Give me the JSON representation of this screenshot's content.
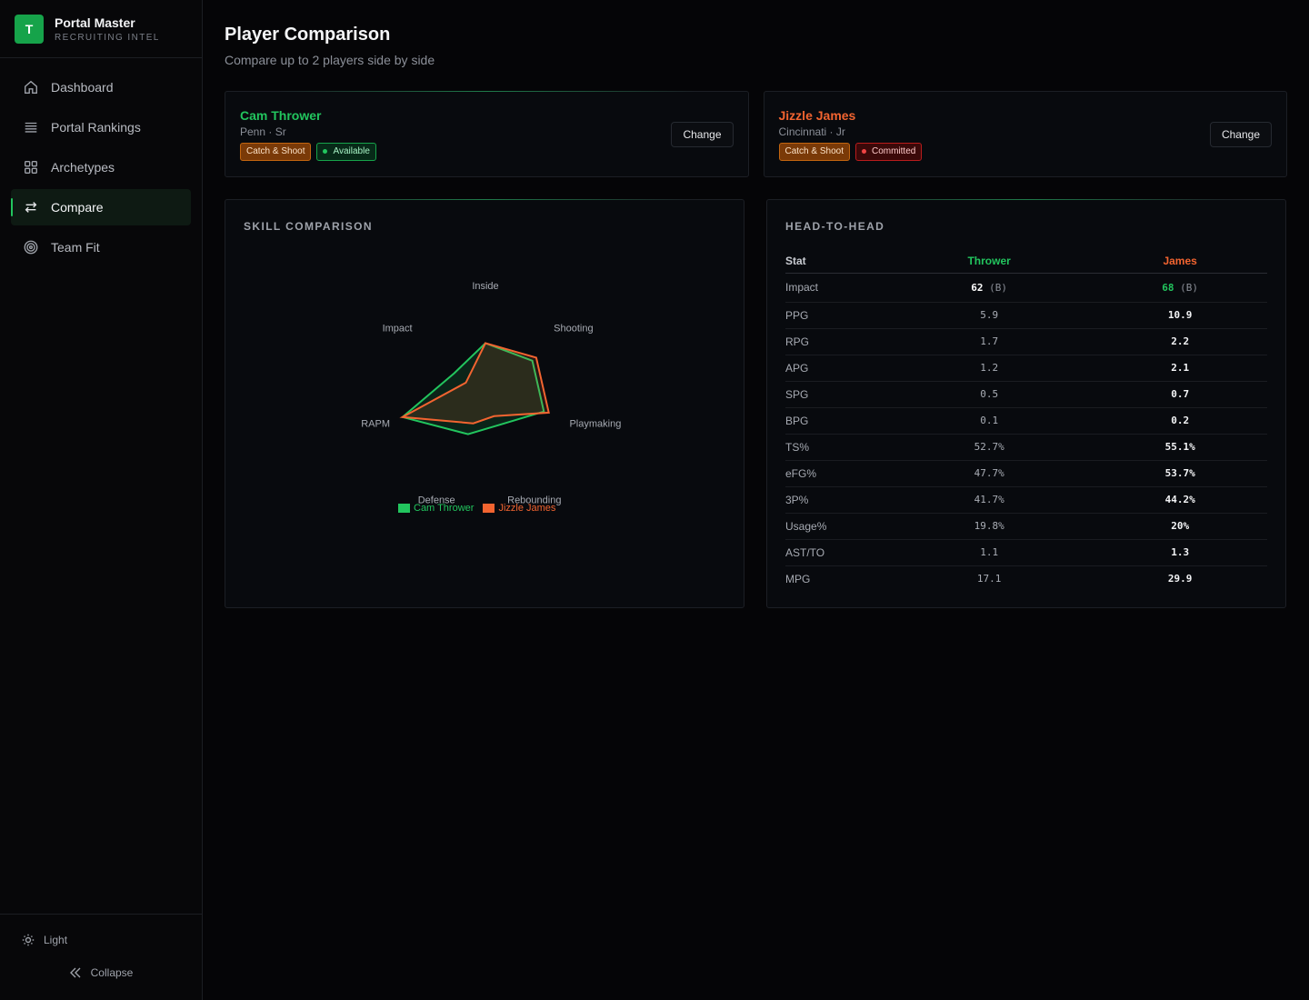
{
  "brand": {
    "logo_letter": "T",
    "name": "Portal Master",
    "subtitle": "RECRUITING INTEL"
  },
  "nav": [
    {
      "label": "Dashboard",
      "icon": "home-icon",
      "active": false
    },
    {
      "label": "Portal Rankings",
      "icon": "list-icon",
      "active": false
    },
    {
      "label": "Archetypes",
      "icon": "grid-icon",
      "active": false
    },
    {
      "label": "Compare",
      "icon": "swap-arrows-icon",
      "active": true
    },
    {
      "label": "Team Fit",
      "icon": "target-icon",
      "active": false
    }
  ],
  "footer": {
    "theme_label": "Light",
    "collapse_label": "Collapse"
  },
  "page": {
    "title": "Player Comparison",
    "subtitle": "Compare up to 2 players side by side"
  },
  "players": [
    {
      "name": "Cam Thrower",
      "meta": "Penn · Sr",
      "archetype": "Catch & Shoot",
      "status": "Available",
      "color": "#22c55e",
      "change_label": "Change"
    },
    {
      "name": "Jizzle James",
      "meta": "Cincinnati · Jr",
      "archetype": "Catch & Shoot",
      "status": "Committed",
      "color": "#f26430",
      "change_label": "Change"
    }
  ],
  "skill_panel": {
    "title": "SKILL COMPARISON"
  },
  "chart_data": {
    "type": "radar",
    "axes": [
      "Inside",
      "Shooting",
      "Playmaking",
      "Rebounding",
      "Defense",
      "RAPM",
      "Impact"
    ],
    "range": [
      0,
      100
    ],
    "series": [
      {
        "name": "Cam Thrower",
        "color": "#22c55e",
        "values": [
          55,
          60,
          60,
          30,
          40,
          85,
          40
        ]
      },
      {
        "name": "Jizzle James",
        "color": "#f26430",
        "values": [
          55,
          65,
          65,
          20,
          28,
          85,
          25
        ]
      }
    ]
  },
  "h2h": {
    "title": "HEAD-TO-HEAD",
    "headers": [
      "Stat",
      "Thrower",
      "James"
    ],
    "impact": {
      "label": "Impact",
      "thrower": "62",
      "thrower_grade": "(B)",
      "james": "68",
      "james_grade": "(B)"
    },
    "rows": [
      [
        "PPG",
        "5.9",
        "10.9"
      ],
      [
        "RPG",
        "1.7",
        "2.2"
      ],
      [
        "APG",
        "1.2",
        "2.1"
      ],
      [
        "SPG",
        "0.5",
        "0.7"
      ],
      [
        "BPG",
        "0.1",
        "0.2"
      ],
      [
        "TS%",
        "52.7%",
        "55.1%"
      ],
      [
        "eFG%",
        "47.7%",
        "53.7%"
      ],
      [
        "3P%",
        "41.7%",
        "44.2%"
      ],
      [
        "Usage%",
        "19.8%",
        "20%"
      ],
      [
        "AST/TO",
        "1.1",
        "1.3"
      ],
      [
        "MPG",
        "17.1",
        "29.9"
      ]
    ]
  }
}
